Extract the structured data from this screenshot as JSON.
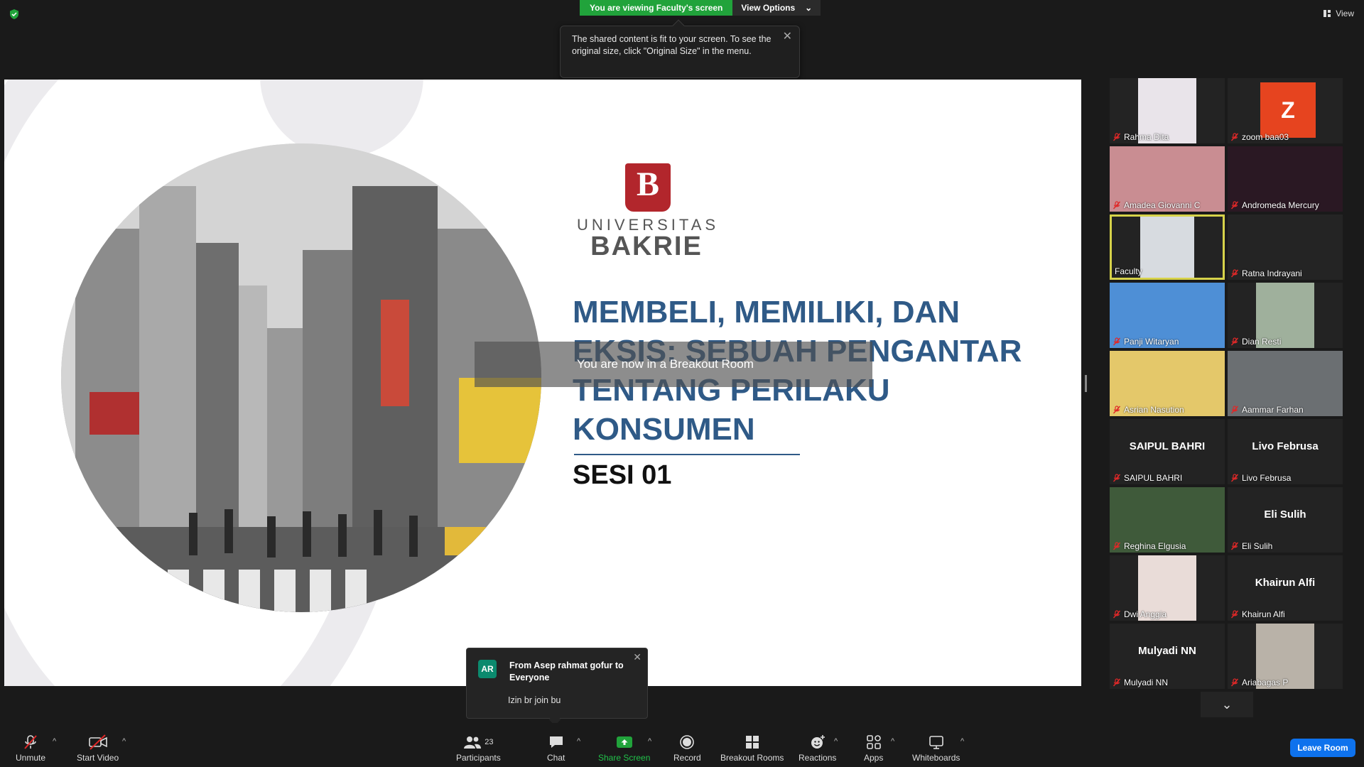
{
  "top": {
    "viewing_label": "You are viewing Faculty's screen",
    "view_options": "View Options",
    "view_right": "View",
    "tooltip": "The shared content is fit to your screen. To see the original size, click \"Original Size\" in the menu."
  },
  "slide": {
    "logo_letter": "B",
    "logo_universitas": "UNIVERSITAS",
    "logo_bakrie": "BAKRIE",
    "title": "MEMBELI, MEMILIKI, DAN EKSIS: SEBUAH PENGANTAR TENTANG PERILAKU KONSUMEN",
    "session": "SESI 01",
    "breakout": "You are now in a Breakout Room"
  },
  "participants": [
    {
      "name": "Rahma Dita",
      "type": "video",
      "color": "#e9e4ea"
    },
    {
      "name": "zoom baa03",
      "type": "avatar",
      "initial": "Z"
    },
    {
      "name": "Amadea Giovanni C",
      "type": "video",
      "color": "#c98d92"
    },
    {
      "name": "Andromeda Mercury",
      "type": "video",
      "color": "#2a1823"
    },
    {
      "name": "Faculty",
      "type": "video",
      "color": "#d7dbe0"
    },
    {
      "name": "Ratna Indrayani",
      "type": "video",
      "color": "#242424"
    },
    {
      "name": "Panji Witaryan",
      "type": "video",
      "color": "#4e8fd6"
    },
    {
      "name": "Dian Resti",
      "type": "video",
      "color": "#9fb09c"
    },
    {
      "name": "Asrian Nasution",
      "type": "video",
      "color": "#e4c86a"
    },
    {
      "name": "Aammar Farhan",
      "type": "video",
      "color": "#6b6f72"
    },
    {
      "name": "SAIPUL BAHRI",
      "type": "text",
      "big": "SAIPUL BAHRI"
    },
    {
      "name": "Livo Februsa",
      "type": "text",
      "big": "Livo Februsa"
    },
    {
      "name": "Reghina Elgusia",
      "type": "video",
      "color": "#3f5a3a"
    },
    {
      "name": "Eli Sulih",
      "type": "text",
      "big": "Eli Sulih"
    },
    {
      "name": "Dwi Anggia",
      "type": "video",
      "color": "#e9dcd8"
    },
    {
      "name": "Khairun Alfi",
      "type": "text",
      "big": "Khairun Alfi"
    },
    {
      "name": "Mulyadi NN",
      "type": "text",
      "big": "Mulyadi NN"
    },
    {
      "name": "Ariabagas P",
      "type": "video",
      "color": "#b9b2a8"
    }
  ],
  "chat": {
    "initials": "AR",
    "from": "From Asep rahmat gofur to Everyone",
    "message": "Izin br join bu"
  },
  "toolbar": {
    "unmute": "Unmute",
    "start_video": "Start Video",
    "participants": "Participants",
    "participant_count": "23",
    "chat": "Chat",
    "share_screen": "Share Screen",
    "record": "Record",
    "breakout_rooms": "Breakout Rooms",
    "reactions": "Reactions",
    "apps": "Apps",
    "whiteboards": "Whiteboards",
    "leave": "Leave Room"
  },
  "colors": {
    "accent_green": "#21a33b",
    "leave_blue": "#0e72ed",
    "title_blue": "#2f5a87",
    "brand_red": "#b2262c"
  }
}
